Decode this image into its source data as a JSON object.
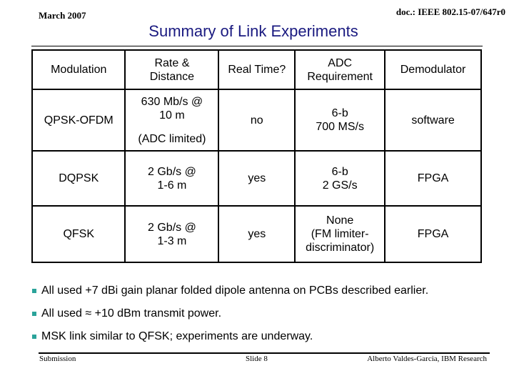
{
  "header": {
    "date": "March 2007",
    "doc_id": "doc.: IEEE 802.15-07/647r0",
    "title": "Summary of Link Experiments"
  },
  "table": {
    "columns": [
      "Modulation",
      "Rate & Distance",
      "Real Time?",
      "ADC Requirement",
      "Demodulator"
    ],
    "column_lines": [
      [
        "Modulation"
      ],
      [
        "Rate &",
        "Distance"
      ],
      [
        "Real Time?"
      ],
      [
        "ADC",
        "Requirement"
      ],
      [
        "Demodulator"
      ]
    ],
    "rows": [
      {
        "modulation": "QPSK-OFDM",
        "rate_l1": "630 Mb/s @",
        "rate_l2": "10 m",
        "rate_note": "(ADC limited)",
        "real_time": "no",
        "adc_l1": "6-b",
        "adc_l2": "700 MS/s",
        "adc_l3": "",
        "demod": "software"
      },
      {
        "modulation": "DQPSK",
        "rate_l1": "2 Gb/s @",
        "rate_l2": "1-6 m",
        "rate_note": "",
        "real_time": "yes",
        "adc_l1": "6-b",
        "adc_l2": "2 GS/s",
        "adc_l3": "",
        "demod": "FPGA"
      },
      {
        "modulation": "QFSK",
        "rate_l1": "2 Gb/s @",
        "rate_l2": "1-3 m",
        "rate_note": "",
        "real_time": "yes",
        "adc_l1": "None",
        "adc_l2": "(FM limiter-",
        "adc_l3": "discriminator)",
        "demod": "FPGA"
      }
    ]
  },
  "bullets": [
    "All used +7 dBi gain planar folded dipole antenna on PCBs described earlier.",
    "All used ≈ +10 dBm transmit power.",
    "MSK link similar to QFSK; experiments are underway."
  ],
  "bullet_color": "#2aa39a",
  "title_color": "#1a1a80",
  "footer": {
    "left": "Submission",
    "center": "Slide 8",
    "right": "Alberto Valdes-Garcia, IBM Research"
  }
}
